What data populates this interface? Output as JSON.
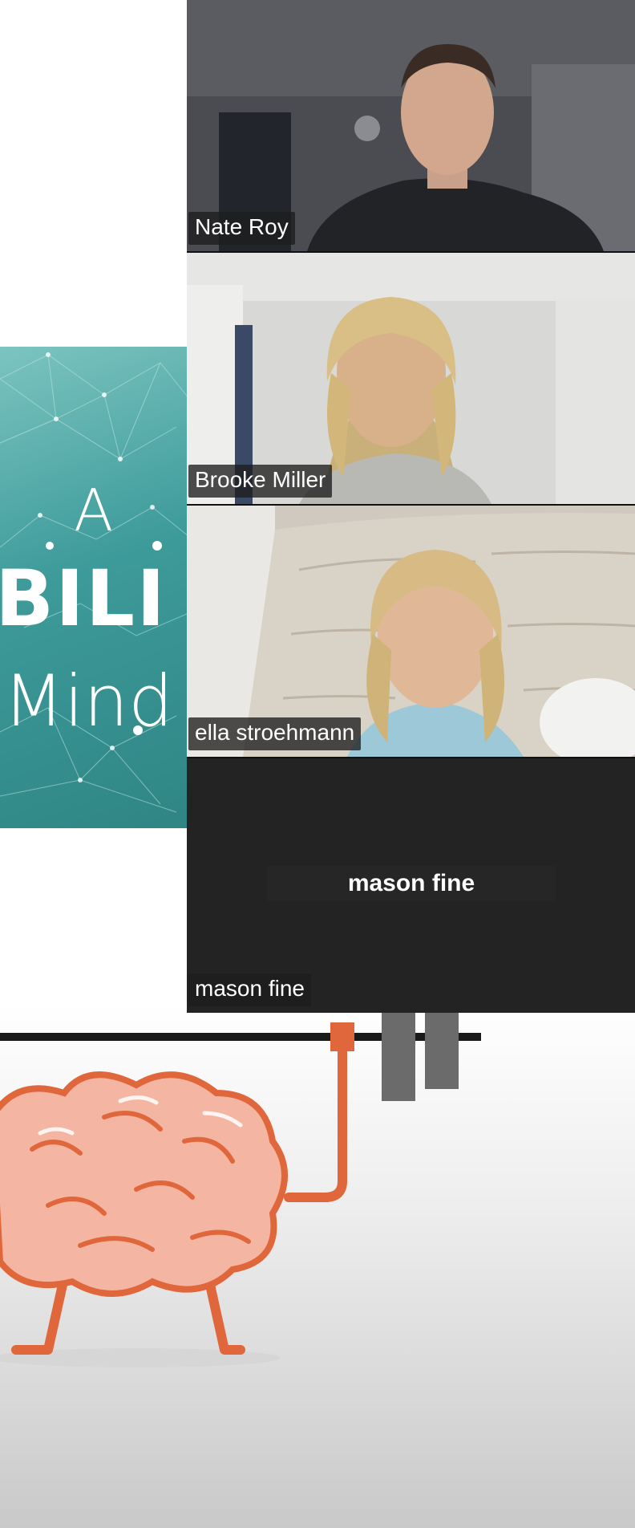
{
  "slide": {
    "logo_line1": "A",
    "logo_line2": "BILI",
    "logo_line3": "Mind",
    "accent_color": "#3d9b9a",
    "illustration": "brain-lifting-barbell"
  },
  "participants": [
    {
      "name": "Nate Roy",
      "video": "on"
    },
    {
      "name": "Brooke Miller",
      "video": "on"
    },
    {
      "name": "ella stroehmann",
      "video": "on"
    },
    {
      "name": "mason fine",
      "video": "off",
      "center_label": "mason fine"
    }
  ]
}
